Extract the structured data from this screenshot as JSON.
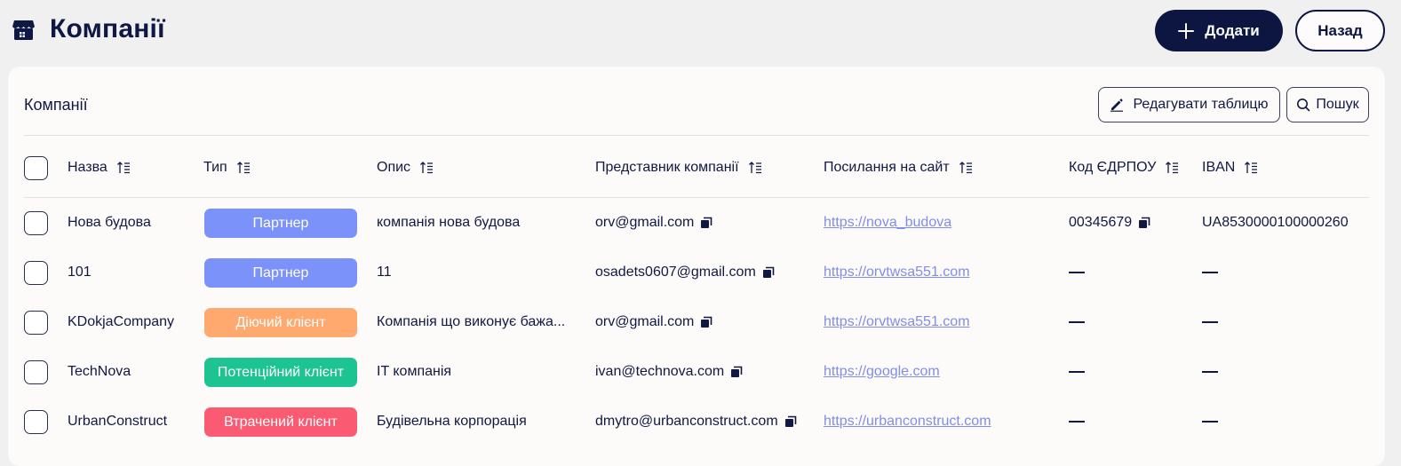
{
  "header": {
    "title": "Компанії",
    "add_label": "Додати",
    "back_label": "Назад"
  },
  "card": {
    "title": "Компанії",
    "edit_label": "Редагувати таблицю",
    "search_label": "Пошук"
  },
  "table": {
    "columns": [
      "Назва",
      "Тип",
      "Опис",
      "Представник компанії",
      "Посилання на сайт",
      "Код ЄДРПОУ",
      "IBAN"
    ],
    "rows": [
      {
        "name": "Нова будова",
        "type": "Партнер",
        "type_color": "#7b92fb",
        "description": "компанія нова будова",
        "rep": "orv@gmail.com",
        "site": "https://nova_budova",
        "edrpou": "00345679",
        "iban": "UA8530000100000260"
      },
      {
        "name": "101",
        "type": "Партнер",
        "type_color": "#7b92fb",
        "description": "11",
        "rep": "osadets0607@gmail.com",
        "site": "https://orvtwsa551.com",
        "edrpou": "",
        "iban": ""
      },
      {
        "name": "KDokjaCompany",
        "type": "Діючий клієнт",
        "type_color": "#ffa96e",
        "description": "Компанія що виконує бажа...",
        "rep": "orv@gmail.com",
        "site": "https://orvtwsa551.com",
        "edrpou": "",
        "iban": ""
      },
      {
        "name": "TechNova",
        "type": "Потенційний клієнт",
        "type_color": "#1dc492",
        "description": "IT компанія",
        "rep": "ivan@technova.com",
        "site": "https://google.com",
        "edrpou": "",
        "iban": ""
      },
      {
        "name": "UrbanConstruct",
        "type": "Втрачений клієнт",
        "type_color": "#fb5a73",
        "description": "Будівельна корпорація",
        "rep": "dmytro@urbanconstruct.com",
        "site": "https://urbanconstruct.com",
        "edrpou": "",
        "iban": ""
      }
    ]
  },
  "icons": {
    "page": "store-icon",
    "add": "plus-icon",
    "edit": "pencil-icon",
    "search": "search-icon",
    "sort": "sort-icon",
    "copy": "copy-icon"
  },
  "colors": {
    "primary": "#0d1640",
    "link": "#7f8ee8",
    "background": "#f0f0f1",
    "card": "#fdfafa"
  }
}
